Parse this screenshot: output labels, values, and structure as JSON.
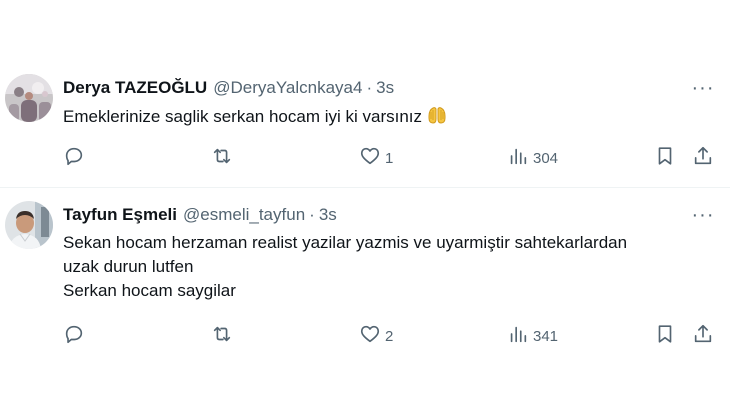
{
  "tweets": [
    {
      "name": "Derya TAZEOĞLU",
      "handle": "@DeryaYalcnkaya4",
      "separator": "·",
      "time": "3s",
      "text_lines": [
        "Emeklerinize saglik serkan hocam iyi ki varsınız"
      ],
      "emoji": "raising-hands-emoji",
      "replies": "",
      "reposts": "",
      "likes": "1",
      "views": "304"
    },
    {
      "name": "Tayfun Eşmeli",
      "handle": "@esmeli_tayfun",
      "separator": "·",
      "time": "3s",
      "text_lines": [
        "Sekan hocam herzaman realist yazilar yazmis ve uyarmiştir sahtekarlardan",
        "uzak durun lutfen",
        "Serkan hocam saygilar"
      ],
      "replies": "",
      "reposts": "",
      "likes": "2",
      "views": "341"
    }
  ],
  "icons": {
    "more": "more-icon",
    "reply": "reply-icon",
    "repost": "repost-icon",
    "like": "heart-icon",
    "views": "views-icon",
    "bookmark": "bookmark-icon",
    "share": "share-icon"
  },
  "colors": {
    "text_primary": "#0f1419",
    "text_secondary": "#536471",
    "divider": "#eff3f4"
  }
}
